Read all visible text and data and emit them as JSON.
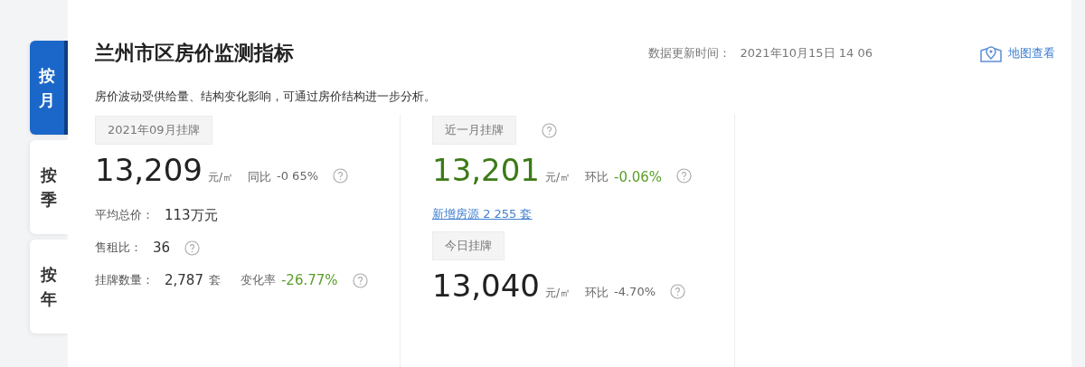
{
  "tabs": [
    {
      "label": "按月",
      "selected": true
    },
    {
      "label": "按季",
      "selected": false
    },
    {
      "label": "按年",
      "selected": false
    }
  ],
  "title": "兰州市区房价监测指标",
  "update": {
    "label": "数据更新时间：",
    "value": "2021年10月15日 14 06"
  },
  "map_link": "地图查看",
  "description": "房价波动受供给量、结构变化影响，可通过房价结构进一步分析。",
  "monthly": {
    "tag": "2021年09月挂牌",
    "price": "13,209",
    "unit": "元/㎡",
    "change": {
      "label": "同比",
      "value": "-0 65%",
      "highlight": false
    },
    "help": true,
    "stats": [
      {
        "label": "平均总价：",
        "value": "113万元",
        "help": false
      },
      {
        "label": "售租比：",
        "value": "36",
        "help": true
      },
      {
        "label": "挂牌数量：",
        "value": "2,787",
        "unit": "套",
        "change": {
          "label": "变化率",
          "value": "-26.77%",
          "highlight": true
        },
        "help": true
      }
    ]
  },
  "listings": [
    {
      "tag": "近一月挂牌",
      "tag_help": true,
      "price": "13,201",
      "highlight": true,
      "unit": "元/㎡",
      "change": {
        "label": "环比",
        "value": "-0.06%",
        "highlight": true
      },
      "help": true,
      "link": "新增房源 2 255 套"
    },
    {
      "tag": "今日挂牌",
      "tag_help": false,
      "price": "13,040",
      "highlight": false,
      "unit": "元/㎡",
      "change": {
        "label": "环比",
        "value": "-4.70%",
        "highlight": false
      },
      "help": true
    }
  ]
}
